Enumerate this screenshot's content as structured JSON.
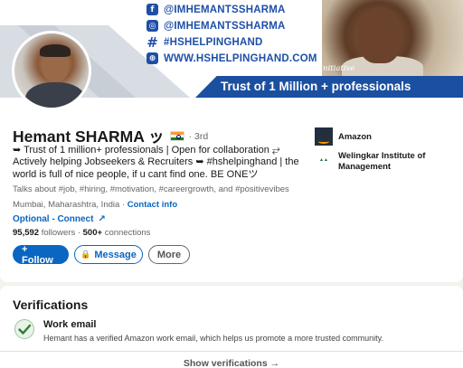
{
  "banner": {
    "social": [
      {
        "icon": "facebook-icon",
        "glyph": "f",
        "text": "@IMHEMANTSSHARMA"
      },
      {
        "icon": "instagram-icon",
        "glyph": "◎",
        "text": "@IMHEMANTSSHARMA"
      },
      {
        "icon": "hashtag-icon",
        "glyph": "#",
        "text": "#HSHELPINGHAND"
      },
      {
        "icon": "globe-icon",
        "glyph": "⊕",
        "text": "WWW.HSHELPINGHAND.COM"
      }
    ],
    "signature": "The Hemant Sharma initiative",
    "strip_text": "Trust of 1 Million + professionals"
  },
  "profile": {
    "name": "Hemant SHARMA ッ",
    "degree": "· 3rd",
    "headline": "➥ Trust of 1 million+ professionals | Open for collaboration ⥂ Actively helping Jobseekers & Recruiters ➥ #hshelpinghand | the world is full of nice people, if u cant find one. BE ONEツ",
    "talks_about": "Talks about #job, #hiring, #motivation, #careergrowth, and #positivevibes",
    "location": "Mumbai, Maharashtra, India ·",
    "contact_info": "Contact info",
    "optional": "Optional - Connect",
    "followers": "95,592",
    "followers_label": "followers ·",
    "connections": "500+",
    "connections_label": "connections"
  },
  "buttons": {
    "follow": "+ Follow",
    "message": "Message",
    "more": "More"
  },
  "orgs": [
    {
      "name": "Amazon"
    },
    {
      "name": "Welingkar Institute of Management"
    }
  ],
  "verifications": {
    "title": "Verifications",
    "item_title": "Work email",
    "item_desc": "Hemant has a verified Amazon work email, which helps us promote a more trusted community.",
    "show_link": "Show verifications →"
  },
  "colors": {
    "accent": "#0a66c2",
    "banner_blue": "#1b4fa0",
    "verified_green": "#2f7d32"
  }
}
